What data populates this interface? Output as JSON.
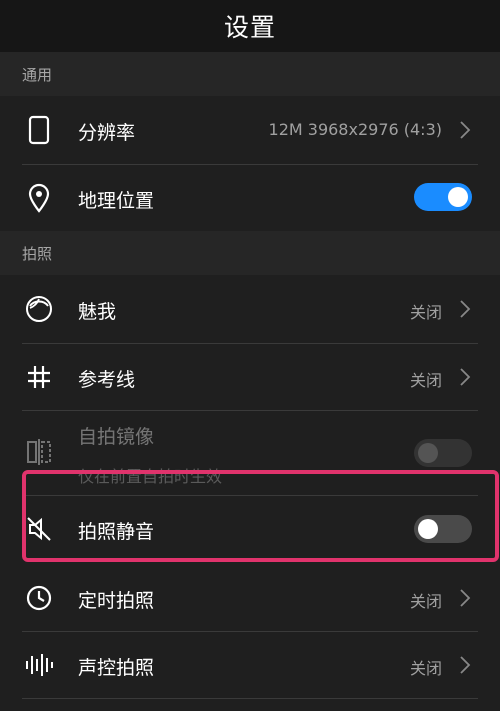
{
  "header": {
    "title": "设置"
  },
  "sections": {
    "general": "通用",
    "photo": "拍照"
  },
  "items": {
    "resolution": {
      "label": "分辨率",
      "value": "12M 3968x2976 (4:3)"
    },
    "location": {
      "label": "地理位置",
      "enabled": true
    },
    "beauty": {
      "label": "魅我",
      "value": "关闭"
    },
    "gridlines": {
      "label": "参考线",
      "value": "关闭"
    },
    "mirror": {
      "label": "自拍镜像",
      "sublabel": "仅在前置自拍时生效",
      "enabled": false
    },
    "mute": {
      "label": "拍照静音",
      "enabled": false
    },
    "timer": {
      "label": "定时拍照",
      "value": "关闭"
    },
    "voice": {
      "label": "声控拍照",
      "value": "关闭"
    }
  },
  "colors": {
    "toggle_on": "#1a8cff",
    "highlight": "#e0336c"
  }
}
